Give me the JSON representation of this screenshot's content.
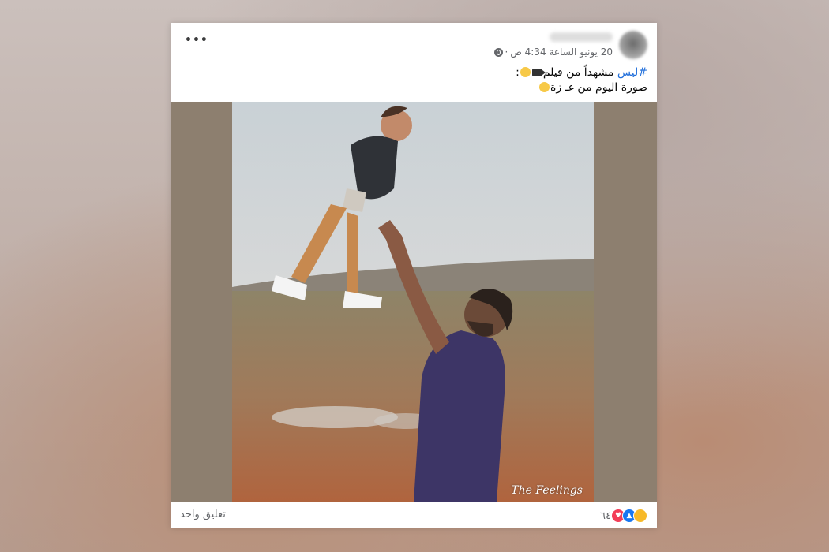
{
  "post": {
    "timestamp": "20 يونيو الساعة 4:34 ص",
    "separator": "·",
    "caption": {
      "hashtag": "#ليس",
      "line1_text": " مشهداً من فيلم",
      "line1_suffix": ":",
      "line2_text": "صورة اليوم من غـ زة"
    },
    "more_label": "•••"
  },
  "media": {
    "watermark": "The Feelings"
  },
  "footer": {
    "reaction_count": "٦٤",
    "comments": "تعليق واحد"
  },
  "icons": {
    "privacy": "globe-icon",
    "more": "more-horizontal-icon",
    "reactions": [
      "sad-icon",
      "like-icon",
      "love-icon"
    ]
  },
  "colors": {
    "hashtag": "#216fdb",
    "like": "#1877f2",
    "love": "#f33e58",
    "sad": "#f7b928"
  }
}
